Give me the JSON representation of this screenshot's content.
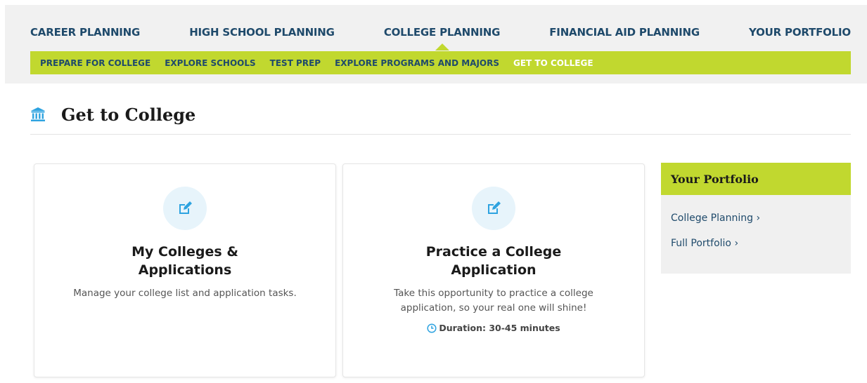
{
  "main_nav": [
    {
      "label": "CAREER PLANNING",
      "active": false
    },
    {
      "label": "HIGH SCHOOL PLANNING",
      "active": false
    },
    {
      "label": "COLLEGE PLANNING",
      "active": true
    },
    {
      "label": "FINANCIAL AID PLANNING",
      "active": false
    },
    {
      "label": "YOUR PORTFOLIO",
      "active": false
    }
  ],
  "sub_nav": [
    {
      "label": "PREPARE FOR COLLEGE",
      "active": false
    },
    {
      "label": "EXPLORE SCHOOLS",
      "active": false
    },
    {
      "label": "TEST PREP",
      "active": false
    },
    {
      "label": "EXPLORE PROGRAMS AND MAJORS",
      "active": false
    },
    {
      "label": "GET TO COLLEGE",
      "active": true
    }
  ],
  "page": {
    "title": "Get to College",
    "title_icon": "bank-icon"
  },
  "cards": [
    {
      "icon": "edit-icon",
      "title_line1": "My Colleges &",
      "title_line2": "Applications",
      "description": "Manage your college list and application tasks."
    },
    {
      "icon": "edit-icon",
      "title_line1": "Practice a College",
      "title_line2": "Application",
      "description_line1": "Take this opportunity to practice a college",
      "description_line2": "application, so your real one will shine!",
      "duration": "Duration: 30-45 minutes",
      "duration_icon": "clock-icon"
    }
  ],
  "portfolio": {
    "title": "Your Portfolio",
    "links": [
      {
        "label": "College Planning",
        "chevron": "›"
      },
      {
        "label": "Full Portfolio",
        "chevron": "›"
      }
    ]
  },
  "colors": {
    "accent_green": "#c1d82f",
    "nav_text": "#1f4a6b",
    "icon_blue": "#2ea3e0",
    "icon_bg": "#e7f4fb"
  }
}
